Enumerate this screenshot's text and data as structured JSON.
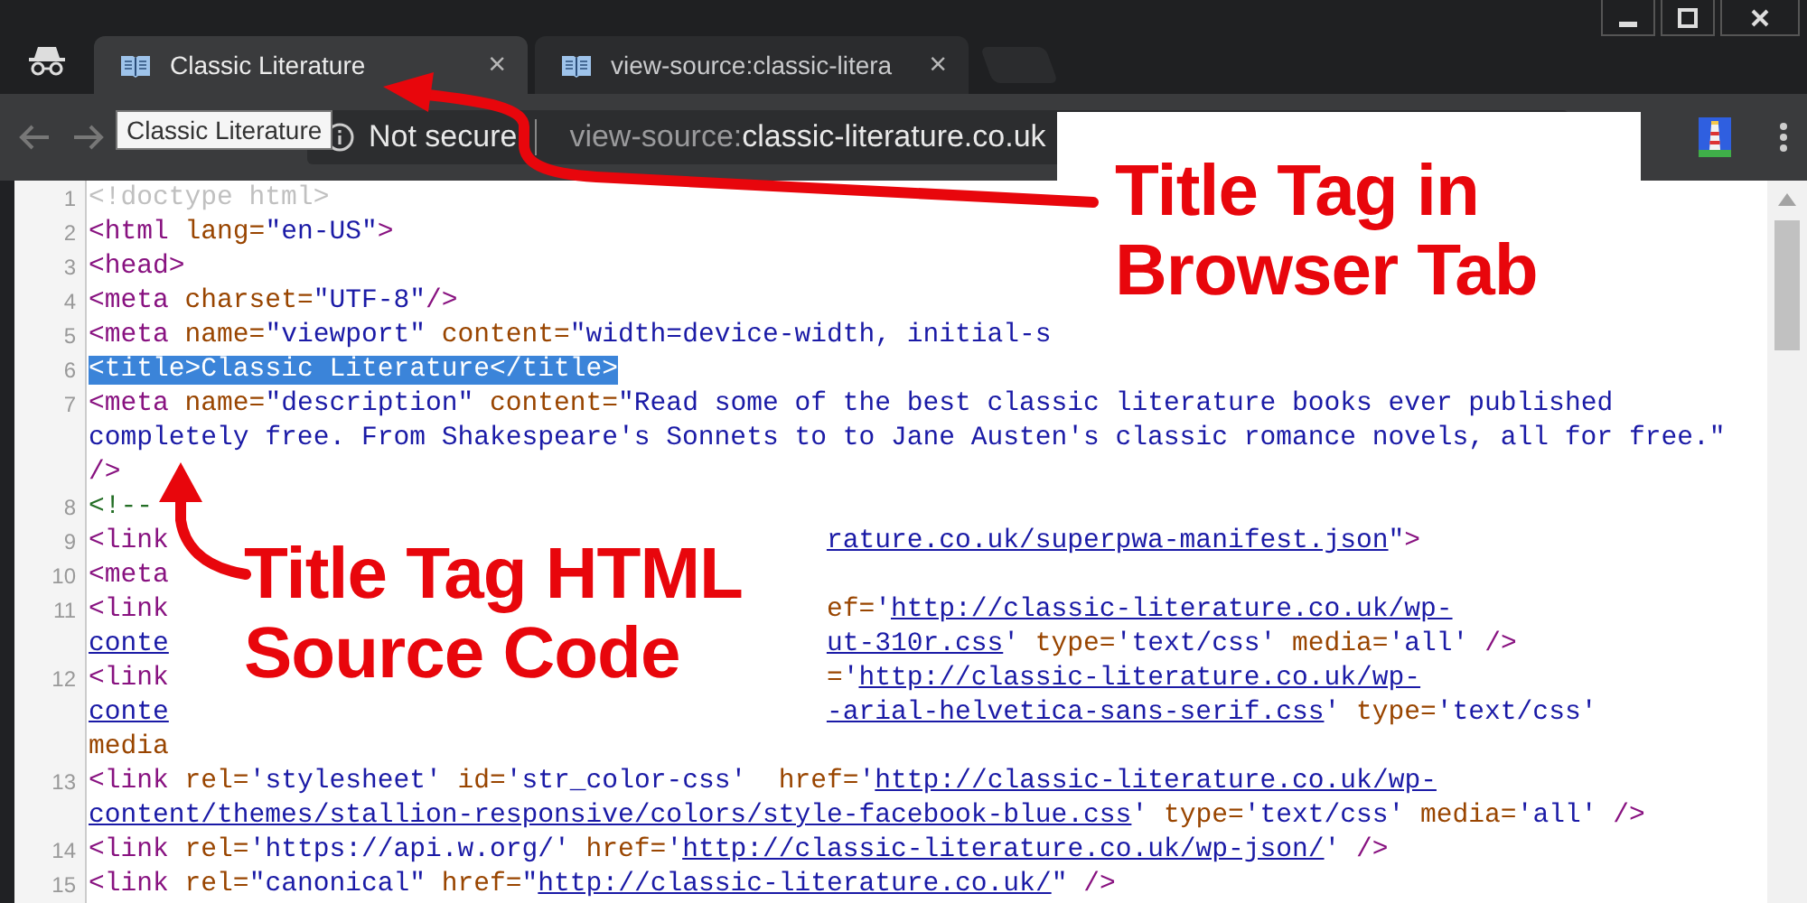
{
  "window_controls": [
    {
      "kind": "minimize"
    },
    {
      "kind": "maximize"
    },
    {
      "kind": "close"
    }
  ],
  "tabs": [
    {
      "title": "Classic Literature",
      "selected": true,
      "close": "×"
    },
    {
      "title": "view-source:classic-litera",
      "selected": false,
      "close": "×"
    }
  ],
  "tooltip": "Classic Literature",
  "address_bar": {
    "security": "Not secure",
    "scheme": "view-source:",
    "host": "classic-literature.co.uk"
  },
  "code_rows": [
    {
      "number": "1",
      "selected": false,
      "head": [
        {
          "kind": "doctype",
          "text": "<!doctype html>"
        }
      ]
    },
    {
      "number": "2",
      "selected": false,
      "head": [
        {
          "kind": "tag",
          "text": "<html"
        },
        {
          "kind": "attr",
          "text": " lang="
        },
        {
          "kind": "value",
          "text": "\"en-US\""
        },
        {
          "kind": "tag",
          "text": ">"
        }
      ]
    },
    {
      "number": "3",
      "selected": false,
      "head": [
        {
          "kind": "tag",
          "text": "<head>"
        }
      ]
    },
    {
      "number": "4",
      "selected": false,
      "head": [
        {
          "kind": "tag",
          "text": "<meta"
        },
        {
          "kind": "attr",
          "text": " charset="
        },
        {
          "kind": "value",
          "text": "\"UTF-8\""
        },
        {
          "kind": "tag",
          "text": "/>"
        }
      ]
    },
    {
      "number": "5",
      "selected": false,
      "head": [
        {
          "kind": "tag",
          "text": "<meta"
        },
        {
          "kind": "attr",
          "text": " name="
        },
        {
          "kind": "value",
          "text": "\"viewport\""
        },
        {
          "kind": "attr",
          "text": " content="
        },
        {
          "kind": "value",
          "text": "\"width=device-width, initial-s"
        }
      ]
    },
    {
      "number": "6",
      "selected": true,
      "head": [
        {
          "kind": "tag",
          "text": "<title>"
        },
        {
          "kind": "value",
          "text": "Classic Literature"
        },
        {
          "kind": "tag",
          "text": "</title>"
        }
      ]
    },
    {
      "number": "7",
      "selected": false,
      "head": [
        {
          "kind": "tag",
          "text": "<meta"
        },
        {
          "kind": "attr",
          "text": " name="
        },
        {
          "kind": "value",
          "text": "\"description\""
        },
        {
          "kind": "attr",
          "text": " content="
        },
        {
          "kind": "value",
          "text": "\"Read some of the best classic literature books ever published"
        }
      ]
    },
    {
      "selected": false,
      "head": [
        {
          "kind": "value",
          "text": "completely free. From Shakespeare's Sonnets to to Jane Austen's classic romance novels, all for free.\""
        }
      ]
    },
    {
      "selected": false,
      "head": [
        {
          "kind": "tag",
          "text": "/>"
        }
      ]
    },
    {
      "number": "8",
      "selected": false,
      "head": [
        {
          "kind": "comment",
          "text": "<!--"
        }
      ]
    },
    {
      "number": "9",
      "selected": false,
      "head": [
        {
          "kind": "tag",
          "text": "<link"
        }
      ],
      "tail": [
        {
          "kind": "link",
          "text": "rature.co.uk/superpwa-manifest.json"
        },
        {
          "kind": "value",
          "text": "\""
        },
        {
          "kind": "tag",
          "text": ">"
        }
      ]
    },
    {
      "number": "10",
      "selected": false,
      "head": [
        {
          "kind": "tag",
          "text": "<meta"
        }
      ]
    },
    {
      "number": "11",
      "selected": false,
      "head": [
        {
          "kind": "tag",
          "text": "<link"
        }
      ],
      "tail": [
        {
          "kind": "attr",
          "text": "ef="
        },
        {
          "kind": "value",
          "text": "'"
        },
        {
          "kind": "link",
          "text": "http://classic-literature.co.uk/wp-"
        }
      ]
    },
    {
      "selected": false,
      "head": [
        {
          "kind": "link",
          "text": "conte"
        }
      ],
      "tail": [
        {
          "kind": "link",
          "text": "ut-310r.css"
        },
        {
          "kind": "value",
          "text": "'"
        },
        {
          "kind": "attr",
          "text": " type="
        },
        {
          "kind": "value",
          "text": "'text/css'"
        },
        {
          "kind": "attr",
          "text": " media="
        },
        {
          "kind": "value",
          "text": "'all'"
        },
        {
          "kind": "tag",
          "text": " />"
        }
      ]
    },
    {
      "number": "12",
      "selected": false,
      "head": [
        {
          "kind": "tag",
          "text": "<link"
        }
      ],
      "tail": [
        {
          "kind": "attr",
          "text": "="
        },
        {
          "kind": "value",
          "text": "'"
        },
        {
          "kind": "link",
          "text": "http://classic-literature.co.uk/wp-"
        }
      ]
    },
    {
      "selected": false,
      "head": [
        {
          "kind": "link",
          "text": "conte"
        }
      ],
      "tail": [
        {
          "kind": "link",
          "text": "-arial-helvetica-sans-serif.css"
        },
        {
          "kind": "value",
          "text": "'"
        },
        {
          "kind": "attr",
          "text": " type="
        },
        {
          "kind": "value",
          "text": "'text/css'"
        }
      ]
    },
    {
      "selected": false,
      "head": [
        {
          "kind": "attr",
          "text": "media"
        }
      ]
    },
    {
      "number": "13",
      "selected": false,
      "head": [
        {
          "kind": "tag",
          "text": "<link"
        },
        {
          "kind": "attr",
          "text": " rel="
        },
        {
          "kind": "value",
          "text": "'stylesheet'"
        },
        {
          "kind": "attr",
          "text": " id="
        },
        {
          "kind": "value",
          "text": "'str_color-css'"
        },
        {
          "kind": "attr",
          "text": "  href="
        },
        {
          "kind": "value",
          "text": "'"
        },
        {
          "kind": "link",
          "text": "http://classic-literature.co.uk/wp-"
        }
      ]
    },
    {
      "selected": false,
      "head": [
        {
          "kind": "link",
          "text": "content/themes/stallion-responsive/colors/style-facebook-blue.css"
        },
        {
          "kind": "value",
          "text": "'"
        },
        {
          "kind": "attr",
          "text": " type="
        },
        {
          "kind": "value",
          "text": "'text/css'"
        },
        {
          "kind": "attr",
          "text": " media="
        },
        {
          "kind": "value",
          "text": "'all'"
        },
        {
          "kind": "tag",
          "text": " />"
        }
      ]
    },
    {
      "number": "14",
      "selected": false,
      "head": [
        {
          "kind": "tag",
          "text": "<link"
        },
        {
          "kind": "attr",
          "text": " rel="
        },
        {
          "kind": "value",
          "text": "'https://api.w.org/'"
        },
        {
          "kind": "attr",
          "text": " href="
        },
        {
          "kind": "value",
          "text": "'"
        },
        {
          "kind": "link",
          "text": "http://classic-literature.co.uk/wp-json/"
        },
        {
          "kind": "value",
          "text": "'"
        },
        {
          "kind": "tag",
          "text": " />"
        }
      ]
    },
    {
      "number": "15",
      "selected": false,
      "head": [
        {
          "kind": "tag",
          "text": "<link"
        },
        {
          "kind": "attr",
          "text": " rel="
        },
        {
          "kind": "value",
          "text": "\"canonical\""
        },
        {
          "kind": "attr",
          "text": " href="
        },
        {
          "kind": "value",
          "text": "\""
        },
        {
          "kind": "link",
          "text": "http://classic-literature.co.uk/"
        },
        {
          "kind": "value",
          "text": "\""
        },
        {
          "kind": "tag",
          "text": " />"
        }
      ]
    }
  ],
  "annotations": [
    {
      "lines": [
        "Title Tag in",
        "Browser Tab"
      ]
    },
    {
      "lines": [
        "Title Tag HTML",
        "Source Code"
      ]
    }
  ]
}
